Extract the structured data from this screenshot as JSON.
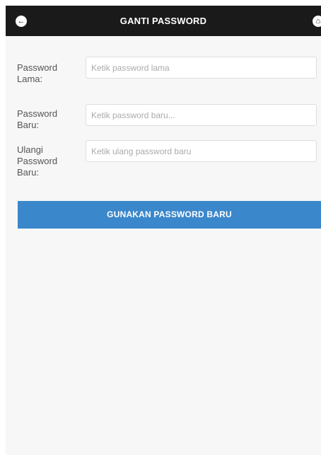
{
  "header": {
    "title": "GANTI PASSWORD",
    "back_icon": "←",
    "home_icon": "⌂"
  },
  "form": {
    "fields": [
      {
        "label_lines": [
          "Password",
          "Lama:"
        ],
        "value": "",
        "placeholder": "Ketik password lama"
      },
      {
        "label_lines": [
          "Password",
          "Baru:"
        ],
        "value": "",
        "placeholder": "Ketik password baru..."
      },
      {
        "label_lines": [
          "Ulangi",
          "Password",
          "Baru:"
        ],
        "value": "",
        "placeholder": "Ketik ulang password baru"
      }
    ],
    "submit_label": "GUNAKAN PASSWORD BARU"
  },
  "colors": {
    "header_bg": "#1a1a1a",
    "primary_button": "#3b87cb",
    "page_bg": "#f7f7f7"
  }
}
